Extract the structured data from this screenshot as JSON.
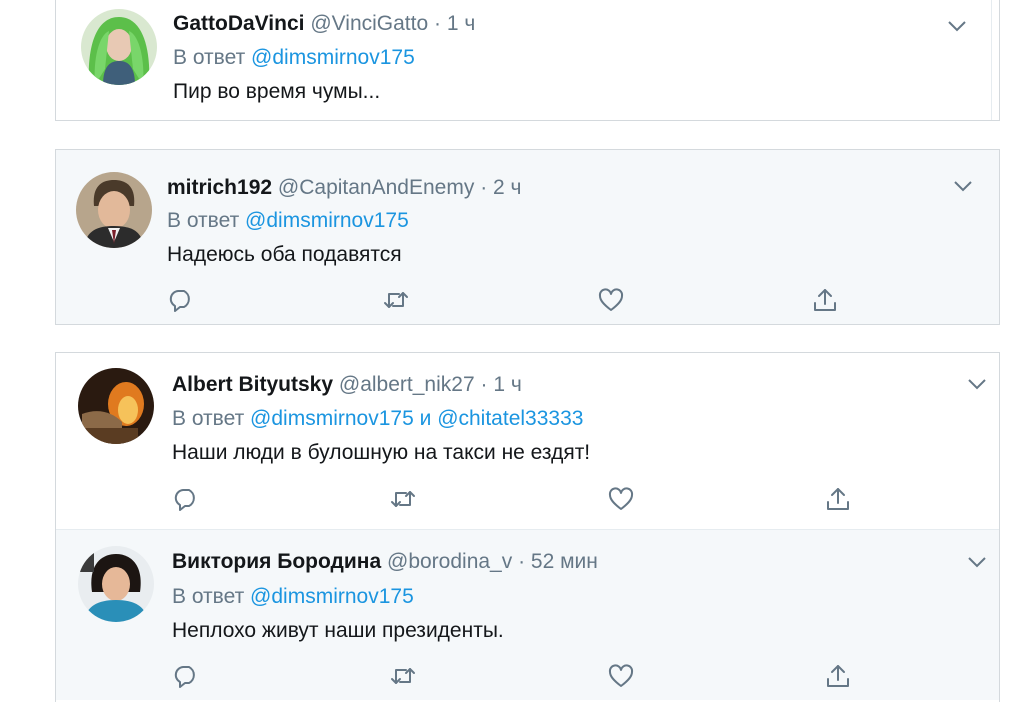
{
  "tweets": [
    {
      "author_name": "GattoDaVinci",
      "handle": "@VinciGatto",
      "separator": "·",
      "time": "1 ч",
      "reply_prefix": "В ответ",
      "mentions": [
        "@dimsmirnov175"
      ],
      "text": "Пир во время чумы..."
    },
    {
      "author_name": "mitrich192",
      "handle": "@CapitanAndEnemy",
      "separator": "·",
      "time": "2 ч",
      "reply_prefix": "В ответ",
      "mentions": [
        "@dimsmirnov175"
      ],
      "text": "Надеюсь оба подавятся"
    },
    {
      "author_name": "Albert Bityutsky",
      "handle": "@albert_nik27",
      "separator": "·",
      "time": "1 ч",
      "reply_prefix": "В ответ",
      "mentions": [
        "@dimsmirnov175",
        "@chitatel33333"
      ],
      "mention_joiner": "и",
      "text": "Наши люди в булошную на такси не ездят!"
    },
    {
      "author_name": "Виктория Бородина",
      "handle": "@borodina_v",
      "separator": "·",
      "time": "52 мин",
      "reply_prefix": "В ответ",
      "mentions": [
        "@dimsmirnov175"
      ],
      "text": "Неплохо живут наши президенты."
    }
  ],
  "actions": [
    "reply-icon",
    "retweet-icon",
    "like-icon",
    "share-icon"
  ],
  "colors": {
    "link": "#1b95e0",
    "secondary_text": "#657786",
    "primary_text": "#14171a",
    "border": "#d4d9dd",
    "hover_background": "#f5f8fa"
  }
}
